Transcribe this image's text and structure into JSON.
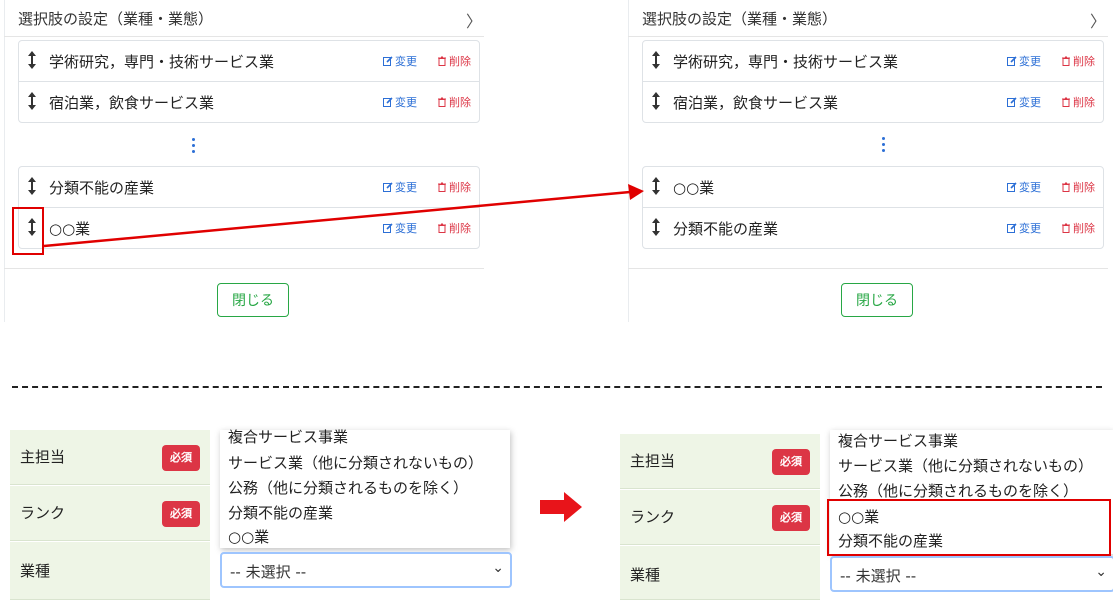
{
  "modal_before": {
    "title": "選択肢の設定（業種・業態）",
    "close_glyph": "〉",
    "top_items": [
      {
        "label": "学術研究，専門・技術サービス業",
        "edit": "変更",
        "delete": "削除"
      },
      {
        "label": "宿泊業，飲食サービス業",
        "edit": "変更",
        "delete": "削除"
      }
    ],
    "bottom_items": [
      {
        "label": "分類不能の産業",
        "edit": "変更",
        "delete": "削除"
      },
      {
        "label": "○○業",
        "edit": "変更",
        "delete": "削除"
      }
    ],
    "close_button": "閉じる"
  },
  "modal_after": {
    "title": "選択肢の設定（業種・業態）",
    "close_glyph": "〉",
    "top_items": [
      {
        "label": "学術研究，専門・技術サービス業",
        "edit": "変更",
        "delete": "削除"
      },
      {
        "label": "宿泊業，飲食サービス業",
        "edit": "変更",
        "delete": "削除"
      }
    ],
    "bottom_items": [
      {
        "label": "○○業",
        "edit": "変更",
        "delete": "削除"
      },
      {
        "label": "分類不能の産業",
        "edit": "変更",
        "delete": "削除"
      }
    ],
    "close_button": "閉じる"
  },
  "form_before": {
    "rows": [
      {
        "label": "主担当",
        "badge": "必須"
      },
      {
        "label": "ランク",
        "badge": "必須"
      },
      {
        "label": "業種",
        "badge": ""
      }
    ],
    "dropdown_options": [
      "複合サービス事業",
      "サービス業（他に分類されないもの）",
      "公務（他に分類されるものを除く）",
      "分類不能の産業",
      "○○業"
    ],
    "select_value": "-- 未選択 --"
  },
  "form_after": {
    "rows": [
      {
        "label": "主担当",
        "badge": "必須"
      },
      {
        "label": "ランク",
        "badge": "必須"
      },
      {
        "label": "業種",
        "badge": ""
      }
    ],
    "dropdown_options": [
      "複合サービス事業",
      "サービス業（他に分類されないもの）",
      "公務（他に分類されるものを除く）",
      "○○業",
      "分類不能の産業"
    ],
    "select_value": "-- 未選択 --"
  },
  "colors": {
    "accent_blue": "#2c6fd6",
    "danger_red": "#dc3545",
    "success_green": "#28a745",
    "annotation_red": "#e00000",
    "label_bg": "#eef5e6"
  }
}
